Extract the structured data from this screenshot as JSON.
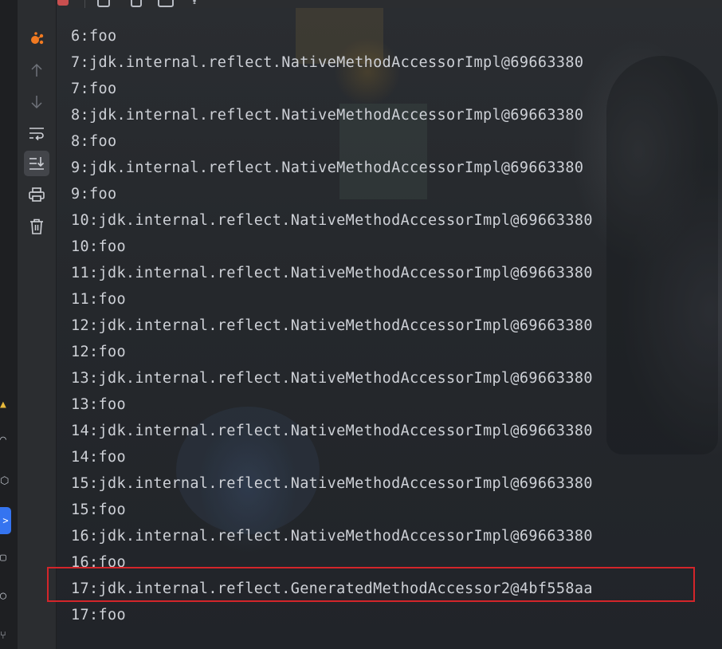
{
  "console": {
    "lines": [
      "6:foo",
      "7:jdk.internal.reflect.NativeMethodAccessorImpl@69663380",
      "7:foo",
      "8:jdk.internal.reflect.NativeMethodAccessorImpl@69663380",
      "8:foo",
      "9:jdk.internal.reflect.NativeMethodAccessorImpl@69663380",
      "9:foo",
      "10:jdk.internal.reflect.NativeMethodAccessorImpl@69663380",
      "10:foo",
      "11:jdk.internal.reflect.NativeMethodAccessorImpl@69663380",
      "11:foo",
      "12:jdk.internal.reflect.NativeMethodAccessorImpl@69663380",
      "12:foo",
      "13:jdk.internal.reflect.NativeMethodAccessorImpl@69663380",
      "13:foo",
      "14:jdk.internal.reflect.NativeMethodAccessorImpl@69663380",
      "14:foo",
      "15:jdk.internal.reflect.NativeMethodAccessorImpl@69663380",
      "15:foo",
      "16:jdk.internal.reflect.NativeMethodAccessorImpl@69663380",
      "16:foo",
      "17:jdk.internal.reflect.GeneratedMethodAccessor2@4bf558aa",
      "17:foo"
    ],
    "highlighted_line": "17:jdk.internal.reflect.GeneratedMethodAccessor2@4bf558aa"
  },
  "side_toolbar": {
    "buttons": [
      {
        "icon": "debug-frames-icon"
      },
      {
        "icon": "up-arrow-icon"
      },
      {
        "icon": "down-arrow-icon"
      },
      {
        "icon": "soft-wrap-icon"
      },
      {
        "icon": "scroll-to-end-icon"
      },
      {
        "icon": "print-icon"
      },
      {
        "icon": "trash-icon"
      }
    ]
  },
  "colors": {
    "text": "#cdd0d6",
    "highlight_border": "#d3252a",
    "accent": "#3574f0",
    "debug_icon": "#f27a21"
  }
}
